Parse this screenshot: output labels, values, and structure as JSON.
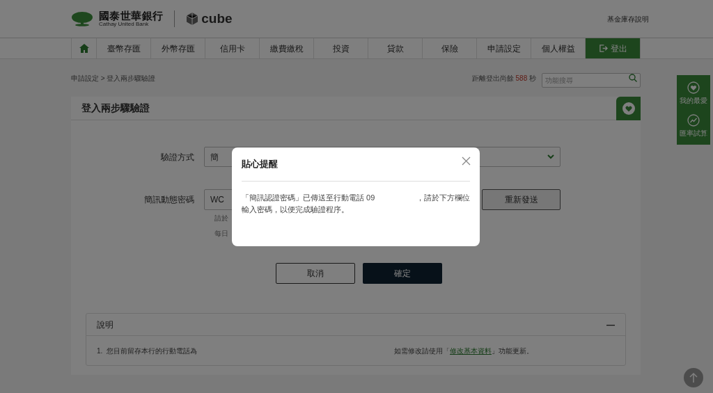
{
  "header": {
    "bank_name": "國泰世華銀行",
    "bank_name_en": "Cathay United Bank",
    "brand": "cube",
    "top_link": "基金庫存說明"
  },
  "nav": {
    "items": [
      {
        "label": "臺幣存匯",
        "kind": "menu"
      },
      {
        "label": "外幣存匯",
        "kind": "menu"
      },
      {
        "label": "信用卡",
        "kind": "menu"
      },
      {
        "label": "繳費繳稅",
        "kind": "menu"
      },
      {
        "label": "投資",
        "kind": "menu"
      },
      {
        "label": "貸款",
        "kind": "menu"
      },
      {
        "label": "保險",
        "kind": "menu"
      },
      {
        "label": "申請設定",
        "kind": "menu"
      },
      {
        "label": "個人權益",
        "kind": "menu"
      },
      {
        "label": "登出",
        "kind": "logout"
      }
    ]
  },
  "breadcrumb": "申請設定 > 登入兩步驟驗證",
  "session": {
    "prefix": "距離登出尚餘",
    "seconds": "588",
    "suffix": "秒"
  },
  "search": {
    "placeholder": "功能搜尋"
  },
  "side_panel": [
    {
      "label": "我的最愛",
      "kind": "heart"
    },
    {
      "label": "匯率試算",
      "kind": "chart"
    }
  ],
  "page_title": "登入兩步驟驗證",
  "form": {
    "method_label": "驗證方式",
    "method_value": "簡",
    "otp_label": "簡訊動態密碼",
    "otp_value": "WC",
    "resend": "重新發送",
    "hint_1": "請於",
    "hint_2": "每日"
  },
  "buttons": {
    "cancel": "取消",
    "confirm": "確定"
  },
  "notes": {
    "title": "說明",
    "collapse": "—",
    "number": "1.",
    "text": "您目前留存本行的行動電話為",
    "prefix": "如需修改請使用「",
    "link": "修改基本資料",
    "suffix": "」功能更新。"
  },
  "dialog": {
    "title": "貼心提醒",
    "line1_start": "「簡訊認證密碼」已傳送至行動電話 09",
    "line1_end": "，請於下方欄位",
    "line2": "輸入密碼，以便完成驗證程序。"
  }
}
